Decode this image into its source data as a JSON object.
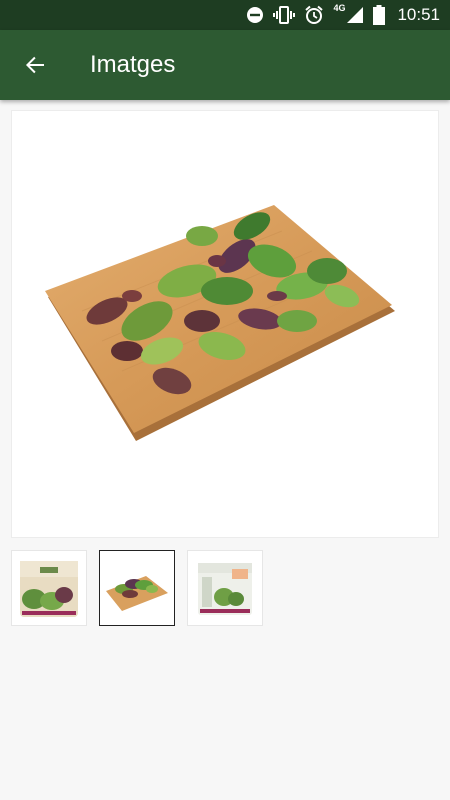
{
  "status_bar": {
    "time": "10:51",
    "network": "4G",
    "icons": [
      "do-not-disturb-icon",
      "vibrate-icon",
      "alarm-icon",
      "signal-icon",
      "battery-icon"
    ]
  },
  "app_bar": {
    "title": "Imatges",
    "back_icon": "arrow-back-icon"
  },
  "gallery": {
    "selected_index": 1,
    "thumbnails": [
      {
        "name": "thumbnail-package-front"
      },
      {
        "name": "thumbnail-salad-board"
      },
      {
        "name": "thumbnail-package-back"
      }
    ]
  },
  "colors": {
    "status_bar": "#1e3d22",
    "app_bar": "#2d5a32",
    "background": "#f7f7f7",
    "board": "#d9a05e"
  }
}
